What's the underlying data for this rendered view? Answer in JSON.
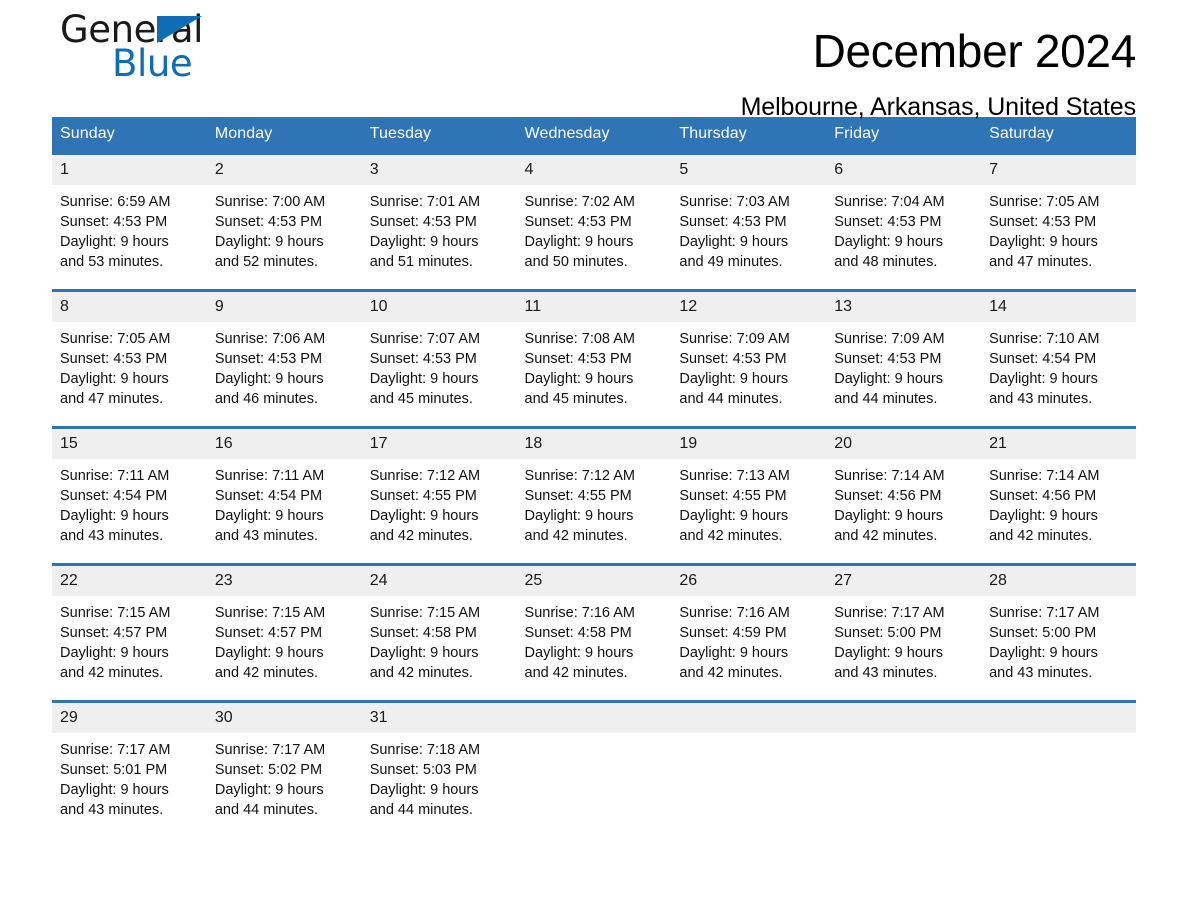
{
  "brand": {
    "name_dark": "General",
    "name_light": "Blue",
    "triangle_icon": "blue-triangle-icon",
    "accent_color": "#0f6cb6"
  },
  "header": {
    "title": "December 2024",
    "subtitle": "Melbourne, Arkansas, United States"
  },
  "theme": {
    "header_blue": "#2f74b5",
    "daynum_gray": "#efefef",
    "text_black": "#111111"
  },
  "calendar": {
    "weekday_headers": [
      "Sunday",
      "Monday",
      "Tuesday",
      "Wednesday",
      "Thursday",
      "Friday",
      "Saturday"
    ],
    "weeks": [
      [
        {
          "day": "1",
          "sunrise": "Sunrise: 6:59 AM",
          "sunset": "Sunset: 4:53 PM",
          "daylight_line1": "Daylight: 9 hours",
          "daylight_line2": "and 53 minutes."
        },
        {
          "day": "2",
          "sunrise": "Sunrise: 7:00 AM",
          "sunset": "Sunset: 4:53 PM",
          "daylight_line1": "Daylight: 9 hours",
          "daylight_line2": "and 52 minutes."
        },
        {
          "day": "3",
          "sunrise": "Sunrise: 7:01 AM",
          "sunset": "Sunset: 4:53 PM",
          "daylight_line1": "Daylight: 9 hours",
          "daylight_line2": "and 51 minutes."
        },
        {
          "day": "4",
          "sunrise": "Sunrise: 7:02 AM",
          "sunset": "Sunset: 4:53 PM",
          "daylight_line1": "Daylight: 9 hours",
          "daylight_line2": "and 50 minutes."
        },
        {
          "day": "5",
          "sunrise": "Sunrise: 7:03 AM",
          "sunset": "Sunset: 4:53 PM",
          "daylight_line1": "Daylight: 9 hours",
          "daylight_line2": "and 49 minutes."
        },
        {
          "day": "6",
          "sunrise": "Sunrise: 7:04 AM",
          "sunset": "Sunset: 4:53 PM",
          "daylight_line1": "Daylight: 9 hours",
          "daylight_line2": "and 48 minutes."
        },
        {
          "day": "7",
          "sunrise": "Sunrise: 7:05 AM",
          "sunset": "Sunset: 4:53 PM",
          "daylight_line1": "Daylight: 9 hours",
          "daylight_line2": "and 47 minutes."
        }
      ],
      [
        {
          "day": "8",
          "sunrise": "Sunrise: 7:05 AM",
          "sunset": "Sunset: 4:53 PM",
          "daylight_line1": "Daylight: 9 hours",
          "daylight_line2": "and 47 minutes."
        },
        {
          "day": "9",
          "sunrise": "Sunrise: 7:06 AM",
          "sunset": "Sunset: 4:53 PM",
          "daylight_line1": "Daylight: 9 hours",
          "daylight_line2": "and 46 minutes."
        },
        {
          "day": "10",
          "sunrise": "Sunrise: 7:07 AM",
          "sunset": "Sunset: 4:53 PM",
          "daylight_line1": "Daylight: 9 hours",
          "daylight_line2": "and 45 minutes."
        },
        {
          "day": "11",
          "sunrise": "Sunrise: 7:08 AM",
          "sunset": "Sunset: 4:53 PM",
          "daylight_line1": "Daylight: 9 hours",
          "daylight_line2": "and 45 minutes."
        },
        {
          "day": "12",
          "sunrise": "Sunrise: 7:09 AM",
          "sunset": "Sunset: 4:53 PM",
          "daylight_line1": "Daylight: 9 hours",
          "daylight_line2": "and 44 minutes."
        },
        {
          "day": "13",
          "sunrise": "Sunrise: 7:09 AM",
          "sunset": "Sunset: 4:53 PM",
          "daylight_line1": "Daylight: 9 hours",
          "daylight_line2": "and 44 minutes."
        },
        {
          "day": "14",
          "sunrise": "Sunrise: 7:10 AM",
          "sunset": "Sunset: 4:54 PM",
          "daylight_line1": "Daylight: 9 hours",
          "daylight_line2": "and 43 minutes."
        }
      ],
      [
        {
          "day": "15",
          "sunrise": "Sunrise: 7:11 AM",
          "sunset": "Sunset: 4:54 PM",
          "daylight_line1": "Daylight: 9 hours",
          "daylight_line2": "and 43 minutes."
        },
        {
          "day": "16",
          "sunrise": "Sunrise: 7:11 AM",
          "sunset": "Sunset: 4:54 PM",
          "daylight_line1": "Daylight: 9 hours",
          "daylight_line2": "and 43 minutes."
        },
        {
          "day": "17",
          "sunrise": "Sunrise: 7:12 AM",
          "sunset": "Sunset: 4:55 PM",
          "daylight_line1": "Daylight: 9 hours",
          "daylight_line2": "and 42 minutes."
        },
        {
          "day": "18",
          "sunrise": "Sunrise: 7:12 AM",
          "sunset": "Sunset: 4:55 PM",
          "daylight_line1": "Daylight: 9 hours",
          "daylight_line2": "and 42 minutes."
        },
        {
          "day": "19",
          "sunrise": "Sunrise: 7:13 AM",
          "sunset": "Sunset: 4:55 PM",
          "daylight_line1": "Daylight: 9 hours",
          "daylight_line2": "and 42 minutes."
        },
        {
          "day": "20",
          "sunrise": "Sunrise: 7:14 AM",
          "sunset": "Sunset: 4:56 PM",
          "daylight_line1": "Daylight: 9 hours",
          "daylight_line2": "and 42 minutes."
        },
        {
          "day": "21",
          "sunrise": "Sunrise: 7:14 AM",
          "sunset": "Sunset: 4:56 PM",
          "daylight_line1": "Daylight: 9 hours",
          "daylight_line2": "and 42 minutes."
        }
      ],
      [
        {
          "day": "22",
          "sunrise": "Sunrise: 7:15 AM",
          "sunset": "Sunset: 4:57 PM",
          "daylight_line1": "Daylight: 9 hours",
          "daylight_line2": "and 42 minutes."
        },
        {
          "day": "23",
          "sunrise": "Sunrise: 7:15 AM",
          "sunset": "Sunset: 4:57 PM",
          "daylight_line1": "Daylight: 9 hours",
          "daylight_line2": "and 42 minutes."
        },
        {
          "day": "24",
          "sunrise": "Sunrise: 7:15 AM",
          "sunset": "Sunset: 4:58 PM",
          "daylight_line1": "Daylight: 9 hours",
          "daylight_line2": "and 42 minutes."
        },
        {
          "day": "25",
          "sunrise": "Sunrise: 7:16 AM",
          "sunset": "Sunset: 4:58 PM",
          "daylight_line1": "Daylight: 9 hours",
          "daylight_line2": "and 42 minutes."
        },
        {
          "day": "26",
          "sunrise": "Sunrise: 7:16 AM",
          "sunset": "Sunset: 4:59 PM",
          "daylight_line1": "Daylight: 9 hours",
          "daylight_line2": "and 42 minutes."
        },
        {
          "day": "27",
          "sunrise": "Sunrise: 7:17 AM",
          "sunset": "Sunset: 5:00 PM",
          "daylight_line1": "Daylight: 9 hours",
          "daylight_line2": "and 43 minutes."
        },
        {
          "day": "28",
          "sunrise": "Sunrise: 7:17 AM",
          "sunset": "Sunset: 5:00 PM",
          "daylight_line1": "Daylight: 9 hours",
          "daylight_line2": "and 43 minutes."
        }
      ],
      [
        {
          "day": "29",
          "sunrise": "Sunrise: 7:17 AM",
          "sunset": "Sunset: 5:01 PM",
          "daylight_line1": "Daylight: 9 hours",
          "daylight_line2": "and 43 minutes."
        },
        {
          "day": "30",
          "sunrise": "Sunrise: 7:17 AM",
          "sunset": "Sunset: 5:02 PM",
          "daylight_line1": "Daylight: 9 hours",
          "daylight_line2": "and 44 minutes."
        },
        {
          "day": "31",
          "sunrise": "Sunrise: 7:18 AM",
          "sunset": "Sunset: 5:03 PM",
          "daylight_line1": "Daylight: 9 hours",
          "daylight_line2": "and 44 minutes."
        },
        {
          "day": "",
          "sunrise": "",
          "sunset": "",
          "daylight_line1": "",
          "daylight_line2": ""
        },
        {
          "day": "",
          "sunrise": "",
          "sunset": "",
          "daylight_line1": "",
          "daylight_line2": ""
        },
        {
          "day": "",
          "sunrise": "",
          "sunset": "",
          "daylight_line1": "",
          "daylight_line2": ""
        },
        {
          "day": "",
          "sunrise": "",
          "sunset": "",
          "daylight_line1": "",
          "daylight_line2": ""
        }
      ]
    ]
  }
}
